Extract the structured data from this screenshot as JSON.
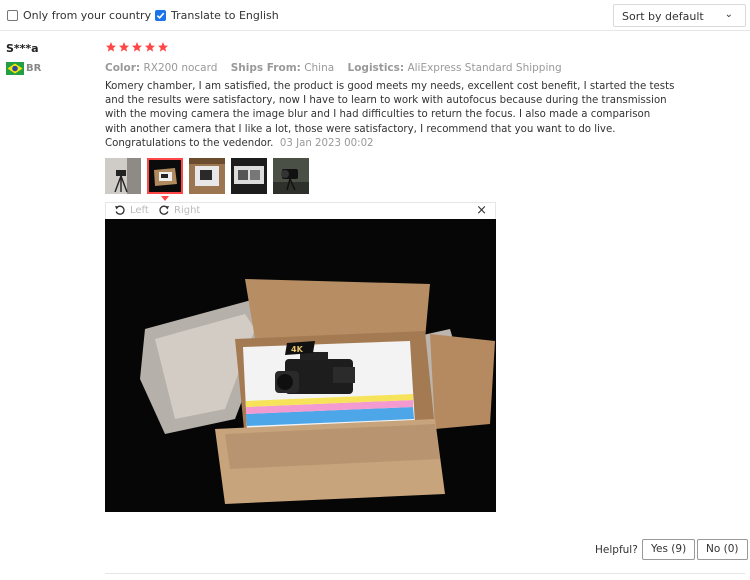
{
  "filters": {
    "only_country_label": "Only from your country",
    "only_country_checked": false,
    "translate_label": "Translate to English",
    "translate_checked": true,
    "sort_value": "Sort by default"
  },
  "review": {
    "user": "S***a",
    "country": "BR",
    "rating": 5,
    "color_label": "Color:",
    "color_value": "RX200 nocard",
    "ships_label": "Ships From:",
    "ships_value": "China",
    "logistics_label": "Logistics:",
    "logistics_value": "AliExpress Standard Shipping",
    "text": "Komery chamber, I am satisfied, the product is good meets my needs, excellent cost benefit, I started the tests and the results were satisfactory, now I have to learn to work with autofocus because during the transmission with the moving camera the image blur and I had difficulties to return the focus. I also made a comparison with another camera that I like a lot, those were satisfactory, I recommend that you want to do live. Congratulations to the vedendor.",
    "date": "03 Jan 2023 00:02",
    "thumbnail_count": 5,
    "active_thumbnail": 2
  },
  "viewer": {
    "left_label": "Left",
    "right_label": "Right",
    "close_symbol": "×",
    "box_badge": "4K"
  },
  "helpful": {
    "label": "Helpful?",
    "yes_label": "Yes (9)",
    "no_label": "No (0)"
  },
  "colors": {
    "accent": "#ff4747",
    "checkbox": "#1a73e8",
    "muted": "#999999"
  }
}
